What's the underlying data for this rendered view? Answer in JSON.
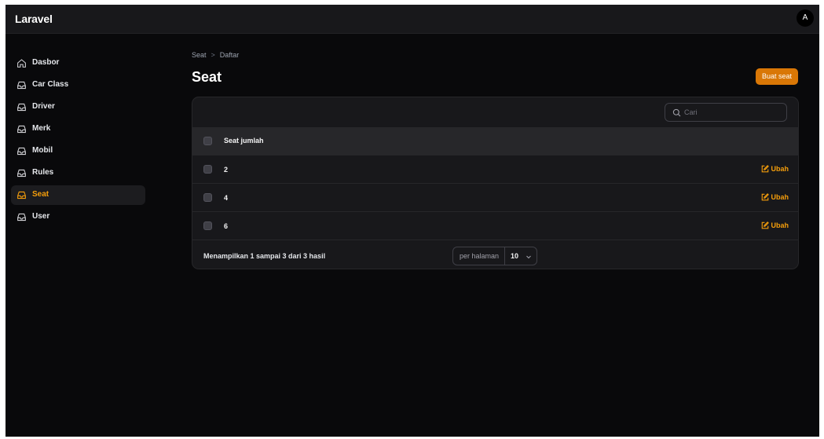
{
  "app": {
    "brand": "Laravel",
    "avatar_initial": "A"
  },
  "sidebar": {
    "items": [
      {
        "label": "Dasbor",
        "icon": "home-icon",
        "active": false
      },
      {
        "label": "Car Class",
        "icon": "tray-icon",
        "active": false
      },
      {
        "label": "Driver",
        "icon": "tray-icon",
        "active": false
      },
      {
        "label": "Merk",
        "icon": "tray-icon",
        "active": false
      },
      {
        "label": "Mobil",
        "icon": "tray-icon",
        "active": false
      },
      {
        "label": "Rules",
        "icon": "tray-icon",
        "active": false
      },
      {
        "label": "Seat",
        "icon": "tray-icon",
        "active": true
      },
      {
        "label": "User",
        "icon": "tray-icon",
        "active": false
      }
    ]
  },
  "breadcrumb": {
    "parent": "Seat",
    "separator": ">",
    "current": "Daftar"
  },
  "page": {
    "title": "Seat",
    "create_label": "Buat seat"
  },
  "search": {
    "placeholder": "Cari"
  },
  "table": {
    "columns": [
      "Seat jumlah"
    ],
    "rows": [
      {
        "seat_jumlah": "2",
        "action": "Ubah"
      },
      {
        "seat_jumlah": "4",
        "action": "Ubah"
      },
      {
        "seat_jumlah": "6",
        "action": "Ubah"
      }
    ]
  },
  "pagination": {
    "summary": "Menampilkan 1 sampai 3 dari 3 hasil",
    "per_page_label": "per halaman",
    "per_page_value": "10"
  },
  "colors": {
    "accent": "#f59e0b",
    "button": "#d97706",
    "background": "#09090b",
    "surface": "#18181b"
  }
}
